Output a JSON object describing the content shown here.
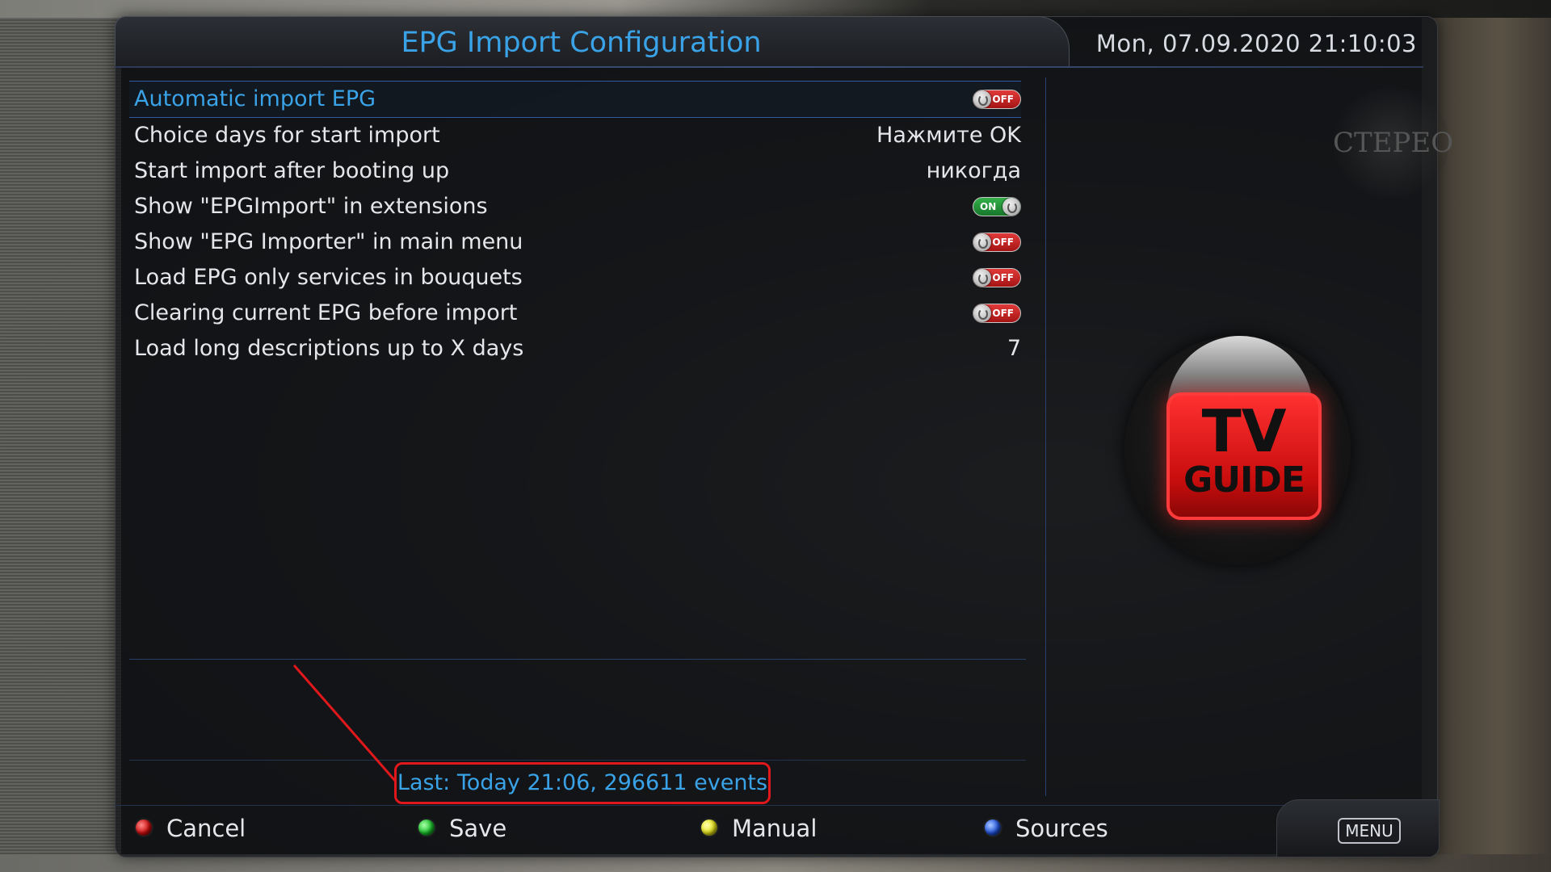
{
  "header": {
    "title": "EPG Import Configuration",
    "datetime": "Mon, 07.09.2020  21:10:03"
  },
  "settings": [
    {
      "label": "Automatic import EPG",
      "type": "toggle",
      "state": "off",
      "toggle_text": "OFF",
      "selected": true
    },
    {
      "label": "Choice days for start import",
      "type": "value",
      "value": "Нажмите OK"
    },
    {
      "label": "Start import after booting up",
      "type": "value",
      "value": "никогда"
    },
    {
      "label": "Show \"EPGImport\" in extensions",
      "type": "toggle",
      "state": "on",
      "toggle_text": "ON"
    },
    {
      "label": "Show \"EPG Importer\" in main menu",
      "type": "toggle",
      "state": "off",
      "toggle_text": "OFF"
    },
    {
      "label": "Load EPG only services in bouquets",
      "type": "toggle",
      "state": "off",
      "toggle_text": "OFF"
    },
    {
      "label": "Clearing current EPG before import",
      "type": "toggle",
      "state": "off",
      "toggle_text": "OFF"
    },
    {
      "label": "Load long descriptions up to X days",
      "type": "value",
      "value": "7"
    }
  ],
  "status": {
    "text": "Last: Today 21:06, 296611 events"
  },
  "buttons": {
    "red": "Cancel",
    "green": "Save",
    "yellow": "Manual",
    "blue": "Sources",
    "menu": "MENU"
  },
  "channel_logo": {
    "text": "CTEPEO"
  },
  "tv_guide": {
    "line1": "TV",
    "line2": "GUIDE"
  },
  "colors": {
    "accent": "#3aa3e8",
    "text": "#e4e6ea",
    "toggle_off": "#d12020",
    "toggle_on": "#2a9a3c",
    "highlight_border": "#e0181b"
  }
}
